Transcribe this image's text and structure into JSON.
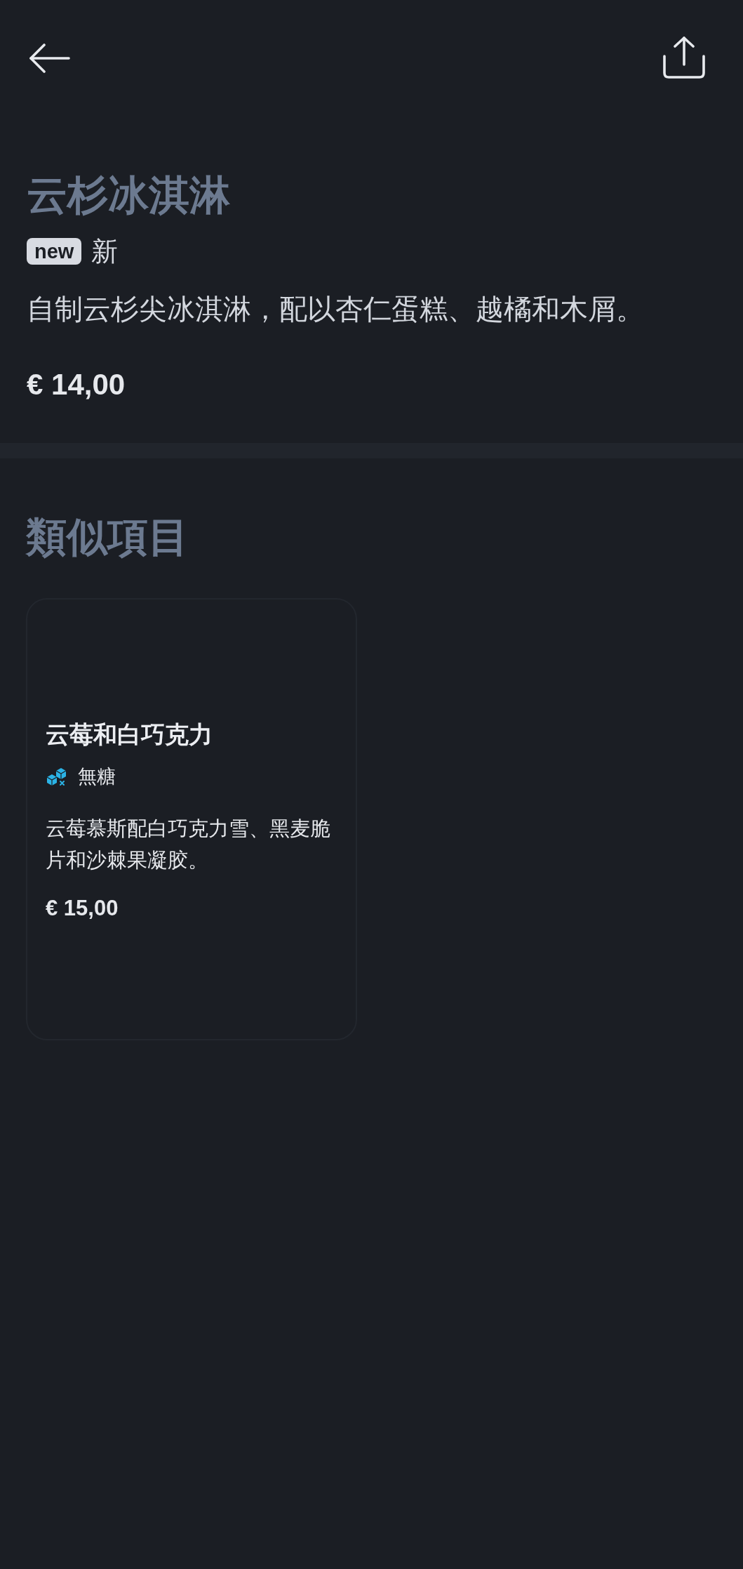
{
  "item": {
    "title": "云杉冰淇淋",
    "tags": [
      {
        "kind": "badge",
        "badge": "new",
        "label": "新"
      }
    ],
    "description": "自制云杉尖冰淇淋，配以杏仁蛋糕、越橘和木屑。",
    "price": "€ 14,00"
  },
  "similar": {
    "heading": "類似項目",
    "items": [
      {
        "title": "云莓和白巧克力",
        "tags": [
          {
            "kind": "sugar_free",
            "label": "無糖"
          }
        ],
        "description": "云莓慕斯配白巧克力雪、黑麦脆片和沙棘果凝胶。",
        "price": "€ 15,00"
      }
    ]
  }
}
